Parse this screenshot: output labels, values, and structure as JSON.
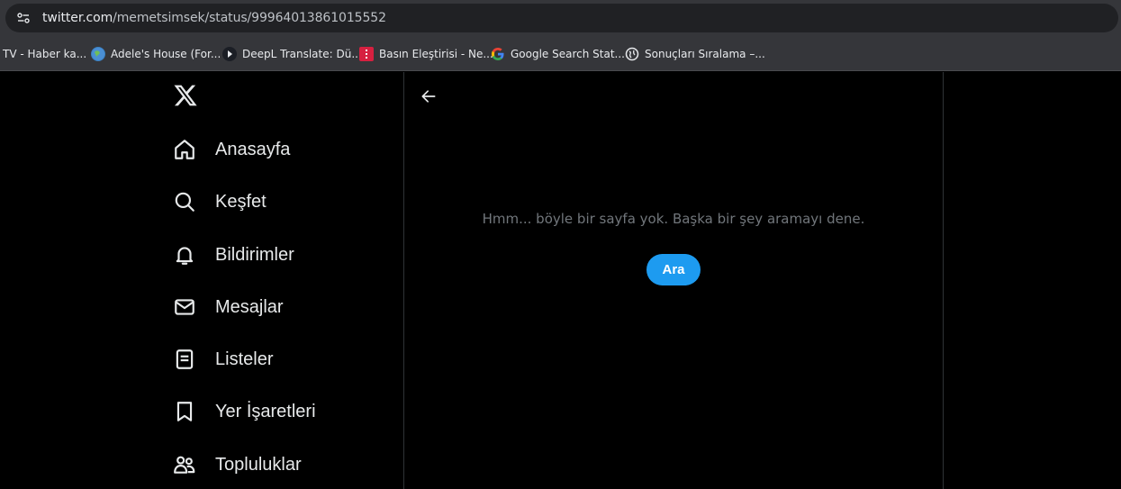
{
  "browser": {
    "url_host": "twitter.com",
    "url_path": "/memetsimsek/status/99964013861015552",
    "bookmarks": [
      {
        "label": "TV - Haber ka...",
        "icon": "none"
      },
      {
        "label": "Adele's House (For...",
        "icon": "globe-blue-icon"
      },
      {
        "label": "DeepL Translate: Dü...",
        "icon": "deepl-icon"
      },
      {
        "label": "Basın Eleştirisi - Ne...",
        "icon": "red-bookmark-icon"
      },
      {
        "label": "Google Search Stat...",
        "icon": "google-icon"
      },
      {
        "label": "Sonuçları Sıralama –...",
        "icon": "globe-icon"
      }
    ]
  },
  "nav": {
    "items": [
      {
        "label": "Anasayfa",
        "icon": "home-icon"
      },
      {
        "label": "Keşfet",
        "icon": "search-icon"
      },
      {
        "label": "Bildirimler",
        "icon": "bell-icon"
      },
      {
        "label": "Mesajlar",
        "icon": "envelope-icon"
      },
      {
        "label": "Listeler",
        "icon": "list-icon"
      },
      {
        "label": "Yer İşaretleri",
        "icon": "bookmark-icon"
      },
      {
        "label": "Topluluklar",
        "icon": "communities-icon"
      }
    ]
  },
  "main": {
    "message": "Hmm... böyle bir sayfa yok. Başka bir şey aramayı dene.",
    "search_button": "Ara"
  },
  "colors": {
    "accent": "#1d9bf0",
    "background": "#000000",
    "text": "#e7e9ea",
    "muted": "#71767b"
  }
}
